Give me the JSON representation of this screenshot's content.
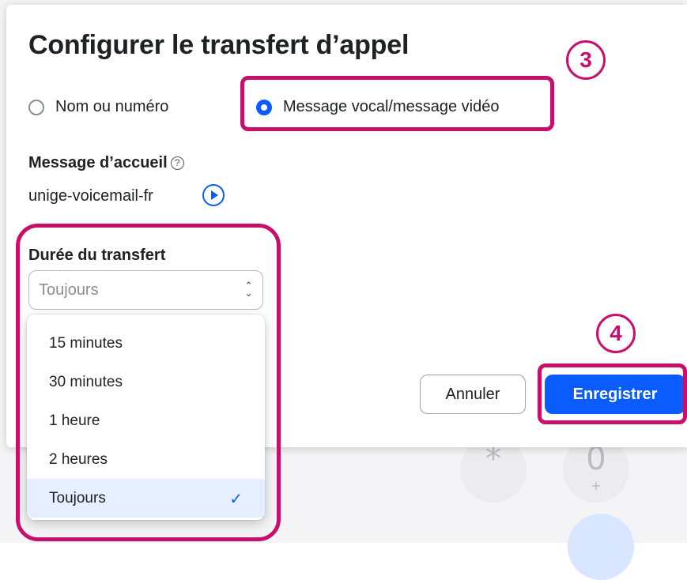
{
  "dialog": {
    "title": "Configurer le transfert d’appel",
    "radio_options": [
      {
        "label": "Nom ou numéro",
        "checked": false
      },
      {
        "label": "Message vocal/message vidéo",
        "checked": true
      }
    ],
    "greeting": {
      "label": "Message d’accueil",
      "value": "unige-voicemail-fr",
      "help_icon": "question-circle-icon",
      "play_icon": "play-circle-icon"
    },
    "duration": {
      "label": "Durée du transfert",
      "selected": "Toujours",
      "options": [
        "15 minutes",
        "30 minutes",
        "1 heure",
        "2 heures",
        "Toujours"
      ]
    },
    "buttons": {
      "cancel": "Annuler",
      "save": "Enregistrer"
    }
  },
  "background_dialer": {
    "keys": [
      {
        "main": "*",
        "sub": ""
      },
      {
        "main": "0",
        "sub": "+"
      }
    ]
  },
  "annotations": {
    "step_3": "3",
    "step_4": "4",
    "highlight_color": "#c8106b"
  },
  "colors": {
    "accent": "#0b5cff",
    "selected_option_bg": "#e6efff"
  }
}
